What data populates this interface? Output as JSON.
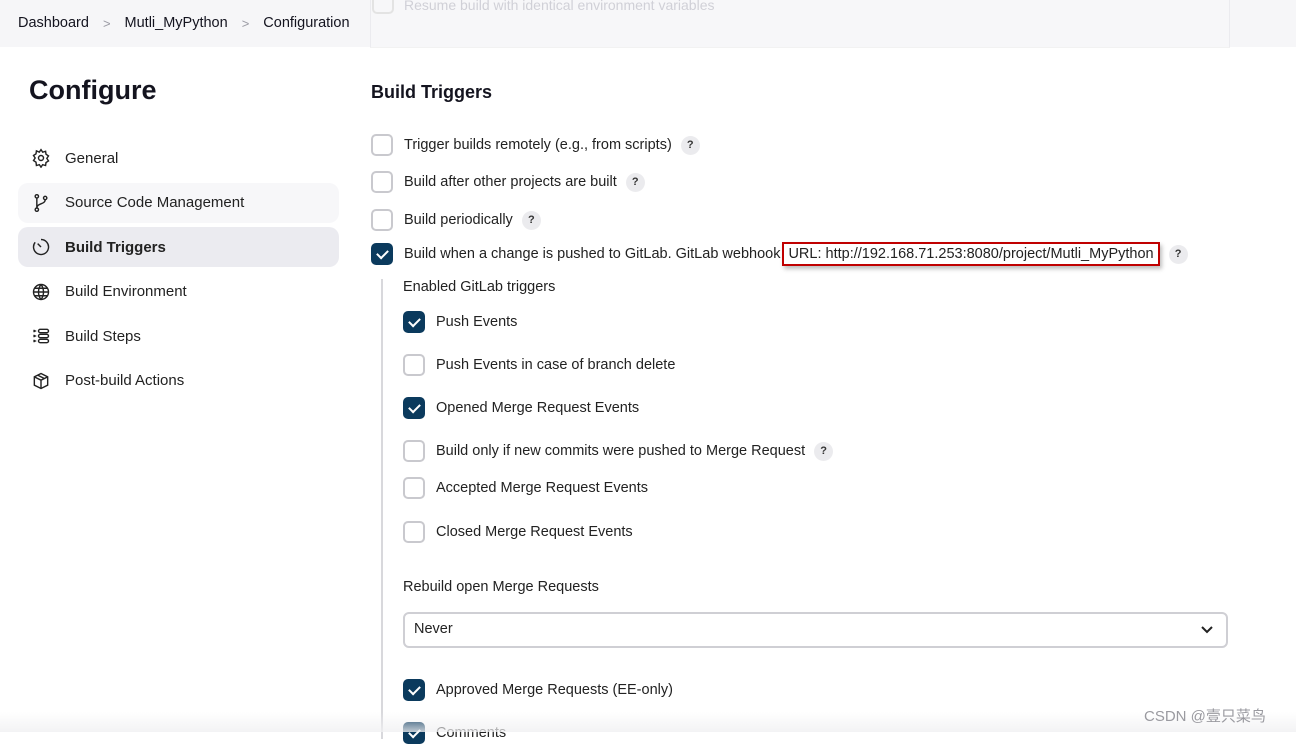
{
  "breadcrumb": [
    "Dashboard",
    "Mutli_MyPython",
    "Configuration"
  ],
  "ghost_option": "Resume build with identical environment variables",
  "page_title": "Configure",
  "sidebar": {
    "items": [
      {
        "label": "General",
        "icon": "gear-icon"
      },
      {
        "label": "Source Code Management",
        "icon": "branch-icon"
      },
      {
        "label": "Build Triggers",
        "icon": "timer-icon",
        "active": true
      },
      {
        "label": "Build Environment",
        "icon": "globe-icon"
      },
      {
        "label": "Build Steps",
        "icon": "list-icon"
      },
      {
        "label": "Post-build Actions",
        "icon": "package-icon"
      }
    ]
  },
  "section_title": "Build Triggers",
  "triggers": [
    {
      "label": "Trigger builds remotely (e.g., from scripts)",
      "checked": false
    },
    {
      "label": "Build after other projects are built",
      "checked": false
    },
    {
      "label": "Build periodically",
      "checked": false
    },
    {
      "label": "Build when a change is pushed to GitLab. GitLab webhook",
      "url": "URL: http://192.168.71.253:8080/project/Mutli_MyPython",
      "checked": true
    }
  ],
  "gitlab": {
    "enabled_label": "Enabled GitLab triggers",
    "options": [
      {
        "label": "Push Events",
        "checked": true
      },
      {
        "label": "Push Events in case of branch delete",
        "checked": false
      },
      {
        "label": "Opened Merge Request Events",
        "checked": true
      },
      {
        "label": "Build only if new commits were pushed to Merge Request",
        "checked": false
      },
      {
        "label": "Accepted Merge Request Events",
        "checked": false
      },
      {
        "label": "Closed Merge Request Events",
        "checked": false
      }
    ],
    "rebuild_label": "Rebuild open Merge Requests",
    "rebuild_value": "Never",
    "after": [
      {
        "label": "Approved Merge Requests (EE-only)",
        "checked": true
      },
      {
        "label": "Comments",
        "checked": true
      }
    ]
  },
  "help_label": "?",
  "watermark": "CSDN @壹只菜鸟",
  "colors": {
    "checked": "#0b3a5d",
    "highlight": "#c00000"
  }
}
